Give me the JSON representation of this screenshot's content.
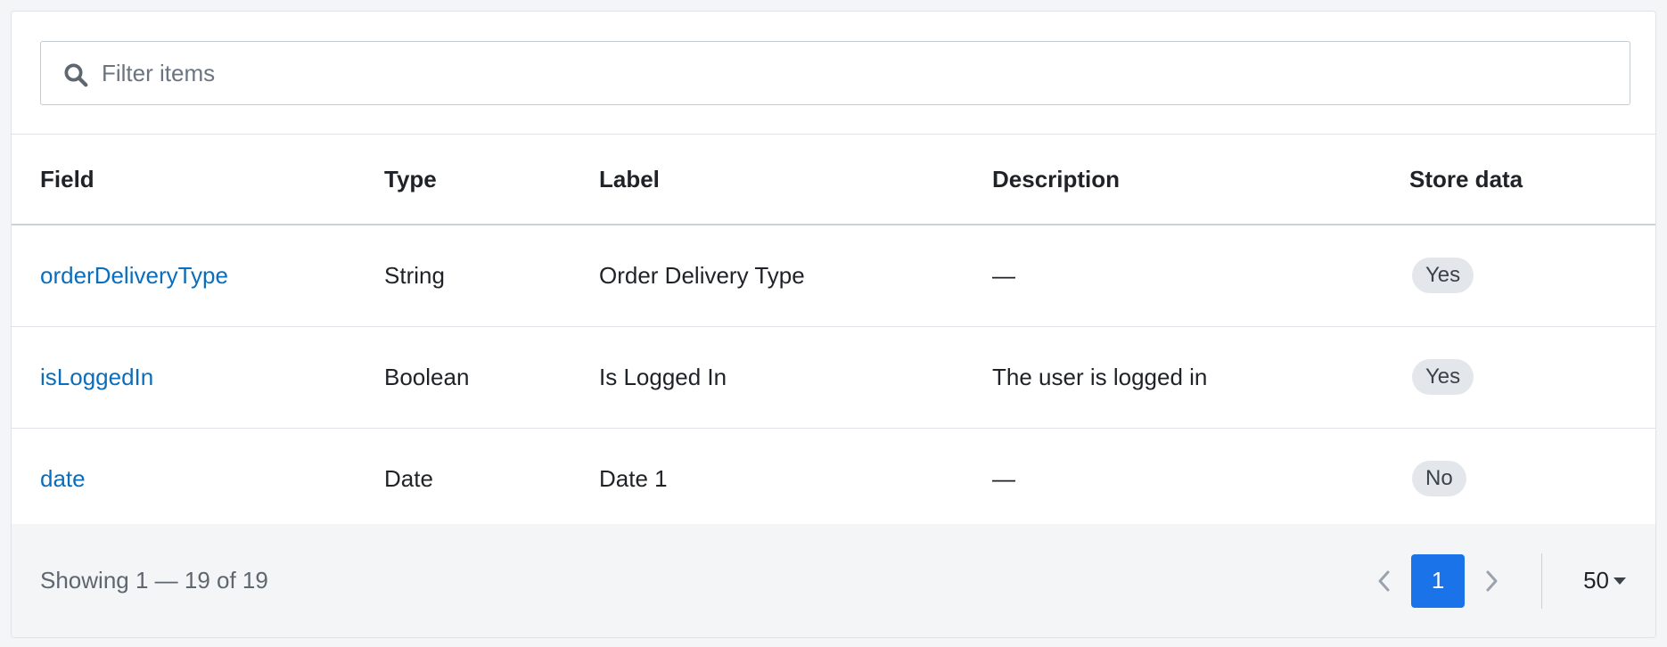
{
  "filter": {
    "placeholder": "Filter items",
    "value": ""
  },
  "table": {
    "headers": {
      "field": "Field",
      "type": "Type",
      "label": "Label",
      "description": "Description",
      "store": "Store data"
    },
    "rows": [
      {
        "field": "orderDeliveryType",
        "type": "String",
        "label": "Order Delivery Type",
        "description": "—",
        "store": "Yes"
      },
      {
        "field": "isLoggedIn",
        "type": "Boolean",
        "label": "Is Logged In",
        "description": "The user is logged in",
        "store": "Yes"
      },
      {
        "field": "date",
        "type": "Date",
        "label": "Date 1",
        "description": "—",
        "store": "No"
      }
    ]
  },
  "footer": {
    "showing": "Showing 1 — 19 of 19",
    "current_page": "1",
    "per_page": "50"
  },
  "colors": {
    "link": "#0a6ebd",
    "accent": "#1a73e8",
    "badge_bg": "#e3e6ea"
  },
  "icons": [
    "search-icon",
    "chevron-left-icon",
    "chevron-right-icon",
    "caret-down-icon"
  ]
}
